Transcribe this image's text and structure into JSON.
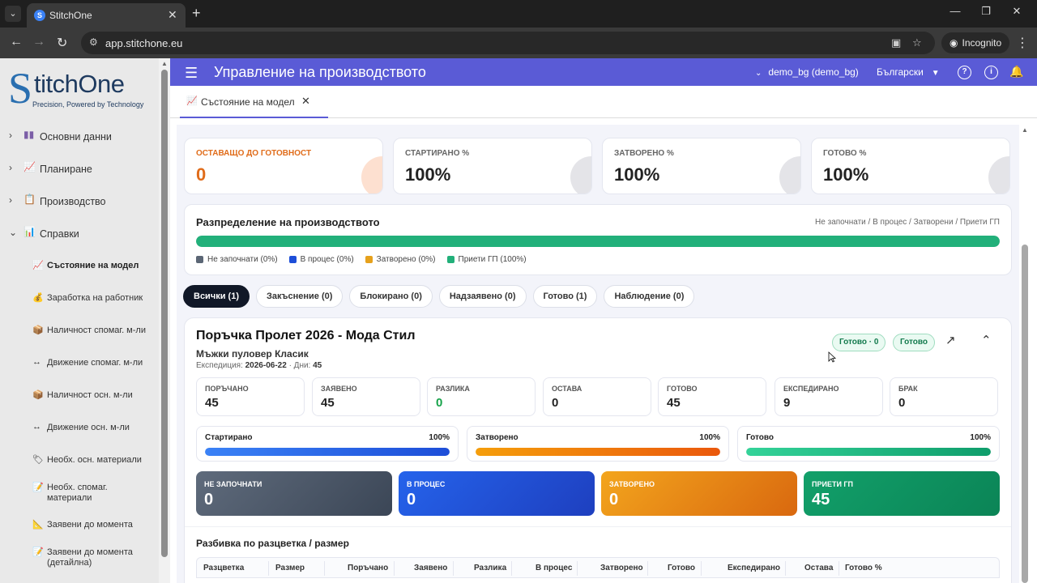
{
  "browser": {
    "tab_title": "StitchOne",
    "favicon": "S",
    "url": "app.stitchone.eu",
    "incognito_label": "Incognito"
  },
  "sidebar": {
    "logo_letter": "S",
    "logo_text": "titchOne",
    "logo_tagline": "Precision, Powered by Technology",
    "sections": [
      {
        "label": "Основни данни",
        "icon": "books-icon"
      },
      {
        "label": "Планиране",
        "icon": "chart-icon"
      },
      {
        "label": "Производство",
        "icon": "clipboard-icon"
      },
      {
        "label": "Справки",
        "icon": "bar-chart-icon"
      }
    ],
    "subitems": [
      {
        "label": "Състояние на модел",
        "icon": "chart-icon"
      },
      {
        "label": "Заработка на работник",
        "icon": "money-bag-icon"
      },
      {
        "label": "Наличност спомаг. м-ли",
        "icon": "box-icon"
      },
      {
        "label": "Движение спомаг. м-ли",
        "icon": "left-right-arrow-icon"
      },
      {
        "label": "Наличност осн. м-ли",
        "icon": "box-icon"
      },
      {
        "label": "Движение осн. м-ли",
        "icon": "left-right-arrow-icon"
      },
      {
        "label": "Необх. осн. материали",
        "icon": "tag-icon"
      },
      {
        "label": "Необх. спомаг. материали",
        "icon": "memo-icon"
      },
      {
        "label": "Заявени до момента",
        "icon": "triangle-ruler-icon"
      },
      {
        "label": "Заявени до момента (детайлна)",
        "icon": "memo-icon"
      }
    ]
  },
  "topbar": {
    "title": "Управление на производството",
    "user": "demo_bg (demo_bg)",
    "language": "Български"
  },
  "page_tab": {
    "label": "Състояние на модел"
  },
  "stats": [
    {
      "label": "ОСТАВАЩО ДО ГОТОВНОСТ",
      "value": "0"
    },
    {
      "label": "СТАРТИРАНО %",
      "value": "100%"
    },
    {
      "label": "ЗАТВОРЕНО %",
      "value": "100%"
    },
    {
      "label": "ГОТОВО %",
      "value": "100%"
    }
  ],
  "distribution": {
    "title": "Разпределение на производството",
    "subtitle": "Не започнати / В процес / Затворени / Приети ГП",
    "legend": [
      {
        "label": "Не започнати (0%)",
        "color": "#5b6675",
        "share": 0
      },
      {
        "label": "В процес (0%)",
        "color": "#1d4ed8",
        "share": 0
      },
      {
        "label": "Затворено (0%)",
        "color": "#e6a11c",
        "share": 0
      },
      {
        "label": "Приети ГП (100%)",
        "color": "#22b07a",
        "share": 100
      }
    ]
  },
  "filters": [
    {
      "label": "Всички (1)"
    },
    {
      "label": "Закъснение (0)"
    },
    {
      "label": "Блокирано (0)"
    },
    {
      "label": "Надзаявено (0)"
    },
    {
      "label": "Готово (1)"
    },
    {
      "label": "Наблюдение (0)"
    }
  ],
  "order": {
    "title": "Поръчка Пролет 2026 - Мода Стил",
    "product": "Мъжки пуловер Класик",
    "expedition_label": "Експедиция:",
    "expedition_date": "2026-06-22",
    "days_label": "· Дни:",
    "days": "45",
    "badge_ready_count": "Готово · 0",
    "badge_ready": "Готово",
    "kpis": [
      {
        "label": "ПОРЪЧАНО",
        "value": "45"
      },
      {
        "label": "ЗАЯВЕНО",
        "value": "45"
      },
      {
        "label": "РАЗЛИКА",
        "value": "0"
      },
      {
        "label": "ОСТАВА",
        "value": "0"
      },
      {
        "label": "ГОТОВО",
        "value": "45"
      },
      {
        "label": "ЕКСПЕДИРАНО",
        "value": "9"
      },
      {
        "label": "БРАК",
        "value": "0"
      }
    ],
    "progress": [
      {
        "label": "Стартирано",
        "pct": "100%",
        "value": 100
      },
      {
        "label": "Затворено",
        "pct": "100%",
        "value": 100
      },
      {
        "label": "Готово",
        "pct": "100%",
        "value": 100
      }
    ],
    "statuses": [
      {
        "label": "НЕ ЗАПОЧНАТИ",
        "value": "0"
      },
      {
        "label": "В ПРОЦЕС",
        "value": "0"
      },
      {
        "label": "ЗАТВОРЕНО",
        "value": "0"
      },
      {
        "label": "ПРИЕТИ ГП",
        "value": "45"
      }
    ],
    "breakdown_title": "Разбивка по разцветка / размер",
    "table_headers": [
      "Разцветка",
      "Размер",
      "Поръчано",
      "Заявено",
      "Разлика",
      "В процес",
      "Затворено",
      "Готово",
      "Експедирано",
      "Остава",
      "Готово %"
    ]
  }
}
